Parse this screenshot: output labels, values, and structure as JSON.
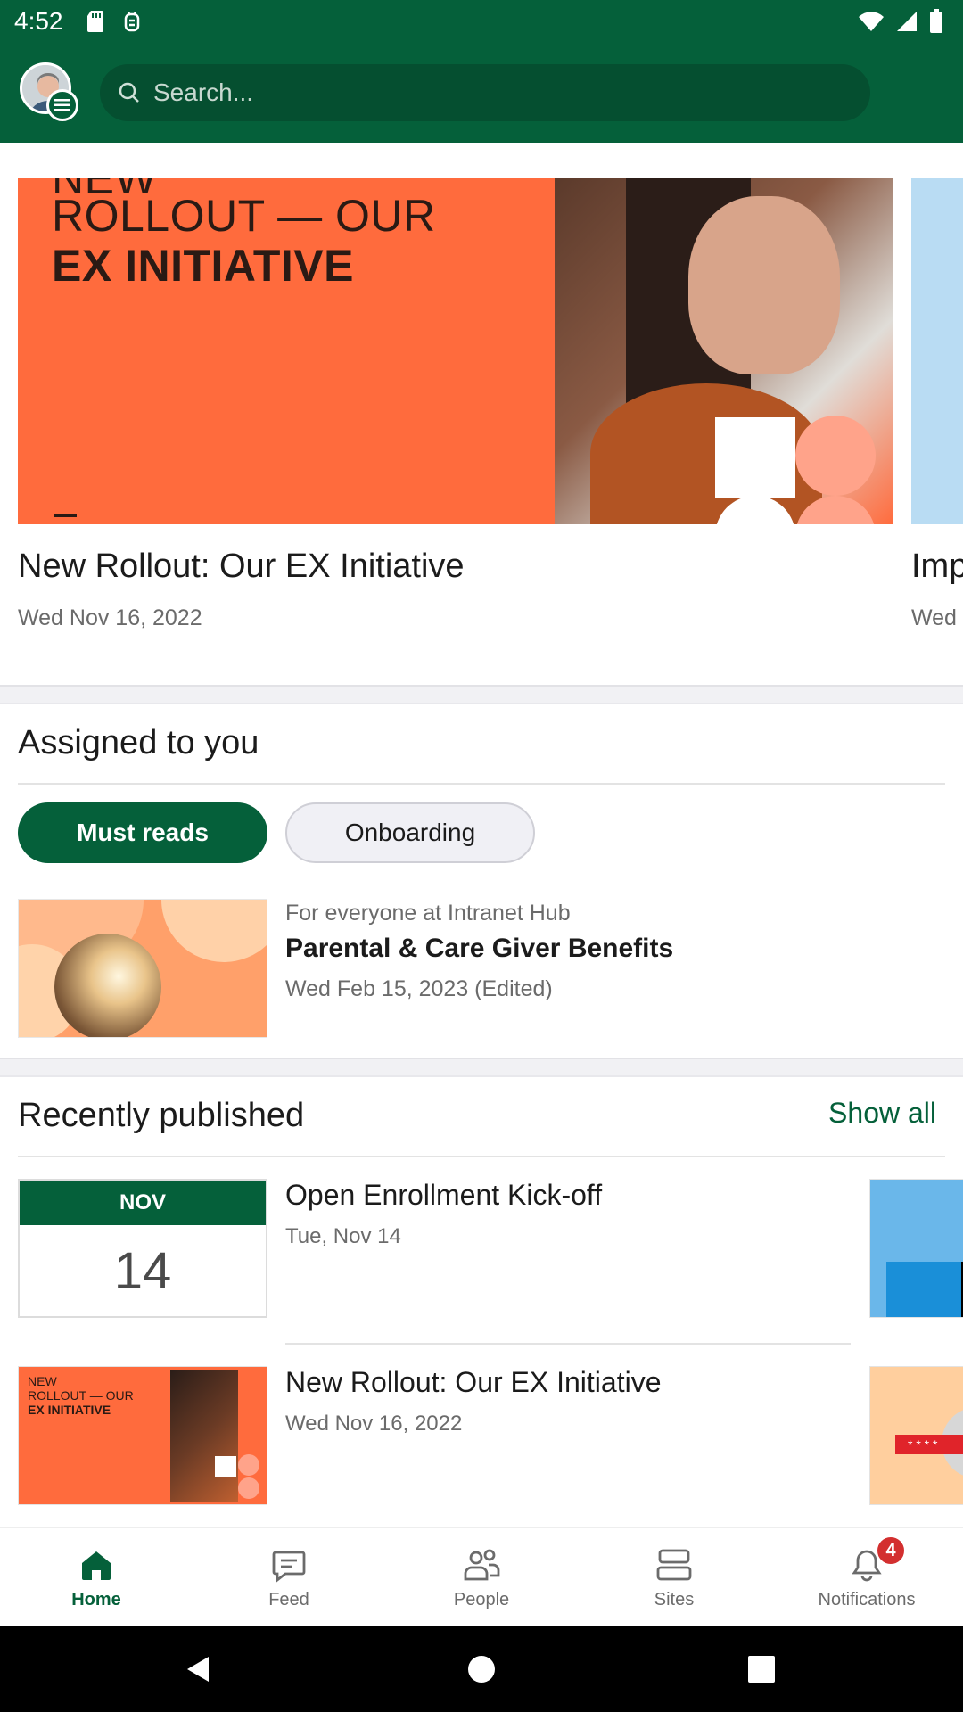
{
  "status_bar": {
    "time": "4:52"
  },
  "search": {
    "placeholder": "Search..."
  },
  "hero": {
    "cards": [
      {
        "image_text_top": "NEW",
        "image_text_line1": "ROLLOUT — OUR",
        "image_text_line2": "EX INITIATIVE",
        "title": "New Rollout: Our EX Initiative",
        "date": "Wed Nov 16, 2022"
      },
      {
        "title": "Imp",
        "date": "Wed"
      }
    ]
  },
  "assigned": {
    "title": "Assigned to you",
    "tabs": [
      {
        "label": "Must reads",
        "selected": true
      },
      {
        "label": "Onboarding",
        "selected": false
      }
    ],
    "items": [
      {
        "audience": "For everyone at Intranet Hub",
        "title": "Parental & Care Giver Benefits",
        "date": "Wed Feb 15, 2023 (Edited)"
      }
    ]
  },
  "recent": {
    "title": "Recently published",
    "show_all": "Show all",
    "items": [
      {
        "month": "NOV",
        "day": "14",
        "title": "Open Enrollment Kick-off",
        "date": "Tue, Nov 14"
      },
      {
        "thumb_text_line1": "NEW",
        "thumb_text_line2": "ROLLOUT — OUR",
        "thumb_text_line3": "EX INITIATIVE",
        "title": "New Rollout: Our EX Initiative",
        "date": "Wed Nov 16, 2022"
      }
    ]
  },
  "nav": {
    "items": [
      {
        "label": "Home",
        "icon": "home-icon",
        "active": true
      },
      {
        "label": "Feed",
        "icon": "feed-icon",
        "active": false
      },
      {
        "label": "People",
        "icon": "people-icon",
        "active": false
      },
      {
        "label": "Sites",
        "icon": "sites-icon",
        "active": false
      },
      {
        "label": "Notifications",
        "icon": "bell-icon",
        "active": false,
        "badge": "4"
      }
    ]
  },
  "colors": {
    "brand": "#05603a",
    "hero_orange": "#ff6b3d",
    "badge": "#d32f2f"
  }
}
